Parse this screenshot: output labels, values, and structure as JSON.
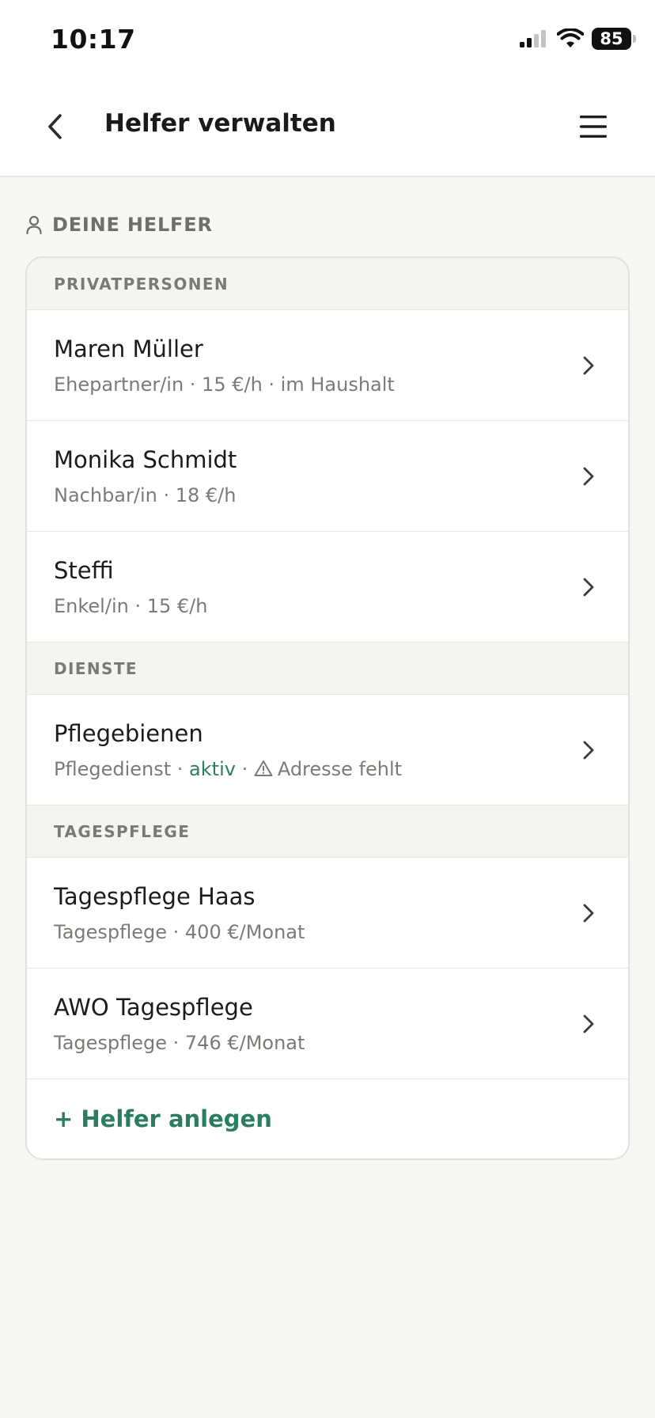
{
  "status_bar": {
    "time": "10:17",
    "battery": "85"
  },
  "nav": {
    "title": "Helfer verwalten"
  },
  "section": {
    "label": "DEINE HELFER"
  },
  "groups": [
    {
      "header": "PRIVATPERSONEN",
      "items": [
        {
          "name": "Maren Müller",
          "sub": "Ehepartner/in · 15 €/h · im Haushalt"
        },
        {
          "name": "Monika Schmidt",
          "sub": "Nachbar/in · 18 €/h"
        },
        {
          "name": "Steffi",
          "sub": "Enkel/in · 15 €/h"
        }
      ]
    },
    {
      "header": "DIENSTE",
      "items": [
        {
          "name": "Pflegebienen",
          "sub_prefix": "Pflegedienst · ",
          "sub_status": "aktiv",
          "sub_sep": " · ",
          "sub_warning": "Adresse fehlt"
        }
      ]
    },
    {
      "header": "TAGESPFLEGE",
      "items": [
        {
          "name": "Tagespflege Haas",
          "sub": "Tagespflege · 400 €/Monat"
        },
        {
          "name": "AWO Tagespflege",
          "sub": "Tagespflege · 746 €/Monat"
        }
      ]
    }
  ],
  "add_label": "+ Helfer anlegen",
  "colors": {
    "accent": "#2a7d62",
    "background": "#f7f7f4",
    "muted": "#7b7b76"
  }
}
